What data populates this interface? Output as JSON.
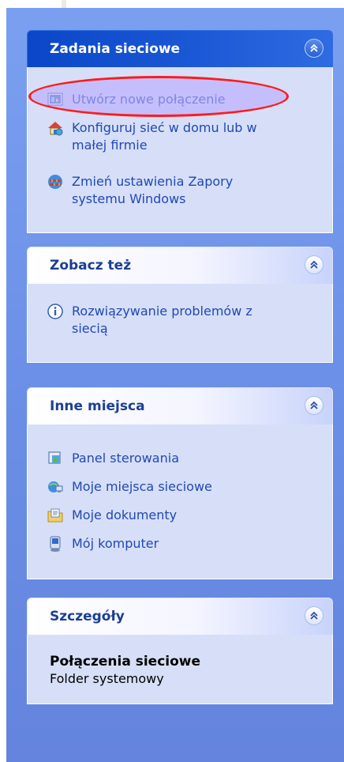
{
  "groups": {
    "network_tasks": {
      "title": "Zadania sieciowe",
      "items": [
        {
          "label": "Utwórz nowe połączenie",
          "icon": "new-connection-icon"
        },
        {
          "label": "Konfiguruj sieć w domu lub w małej firmie",
          "icon": "home-network-icon"
        },
        {
          "label": "Zmień ustawienia Zapory systemu Windows",
          "icon": "firewall-icon"
        }
      ]
    },
    "see_also": {
      "title": "Zobacz też",
      "items": [
        {
          "label": "Rozwiązywanie problemów z siecią",
          "icon": "info-icon"
        }
      ]
    },
    "other_places": {
      "title": "Inne miejsca",
      "items": [
        {
          "label": "Panel sterowania",
          "icon": "control-panel-icon"
        },
        {
          "label": "Moje miejsca sieciowe",
          "icon": "network-places-icon"
        },
        {
          "label": "Moje dokumenty",
          "icon": "documents-icon"
        },
        {
          "label": "Mój komputer",
          "icon": "computer-icon"
        }
      ]
    },
    "details": {
      "title": "Szczegóły",
      "name": "Połączenia sieciowe",
      "type": "Folder systemowy"
    }
  },
  "colors": {
    "pane_background": "#7b9ff0",
    "special_header": "#0a47c8",
    "link_text": "#2148b7",
    "group_title": "#1c3f94",
    "annotation": "#ff1b1b"
  }
}
